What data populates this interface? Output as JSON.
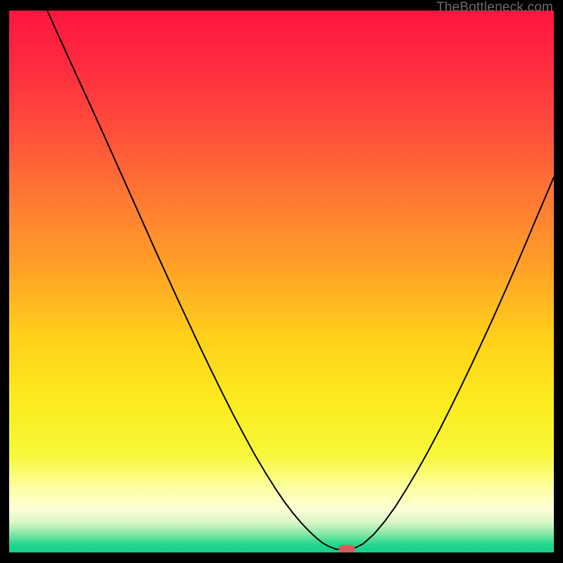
{
  "watermark": "TheBottleneck.com",
  "colors": {
    "frame": "#000000",
    "curve": "#000000",
    "marker_fill": "#d85a5a",
    "marker_stroke": "#d85a5a",
    "gradient_stops": [
      {
        "offset": 0.0,
        "color": "#ff153f"
      },
      {
        "offset": 0.1,
        "color": "#ff2b3f"
      },
      {
        "offset": 0.22,
        "color": "#ff4e3c"
      },
      {
        "offset": 0.35,
        "color": "#ff7a33"
      },
      {
        "offset": 0.48,
        "color": "#ffa326"
      },
      {
        "offset": 0.6,
        "color": "#ffcf1a"
      },
      {
        "offset": 0.72,
        "color": "#fceb1e"
      },
      {
        "offset": 0.82,
        "color": "#f7f83a"
      },
      {
        "offset": 0.88,
        "color": "#fdfea0"
      },
      {
        "offset": 0.92,
        "color": "#fefed8"
      },
      {
        "offset": 0.945,
        "color": "#d9f7c6"
      },
      {
        "offset": 0.965,
        "color": "#88e9a6"
      },
      {
        "offset": 0.985,
        "color": "#24d890"
      },
      {
        "offset": 1.0,
        "color": "#17cf88"
      }
    ]
  },
  "chart_data": {
    "type": "line",
    "title": "",
    "xlabel": "",
    "ylabel": "",
    "xlim": [
      0,
      100
    ],
    "ylim": [
      0,
      100
    ],
    "x": [
      7.0,
      9.0,
      11.0,
      13.0,
      15.0,
      17.0,
      19.0,
      21.0,
      23.0,
      25.0,
      27.0,
      29.0,
      31.0,
      33.0,
      35.0,
      37.0,
      39.0,
      41.0,
      43.0,
      45.0,
      47.0,
      49.0,
      50.5,
      52.0,
      53.5,
      55.0,
      56.5,
      57.5,
      58.5,
      60.0,
      61.5,
      63.0,
      65.0,
      67.0,
      69.0,
      71.0,
      73.0,
      75.0,
      77.0,
      79.0,
      81.0,
      83.0,
      85.0,
      87.0,
      89.0,
      91.0,
      93.0,
      95.0,
      97.0,
      99.0,
      100.0
    ],
    "values": [
      100.0,
      95.5,
      91.1,
      86.7,
      82.3,
      77.9,
      73.4,
      68.9,
      64.4,
      59.9,
      55.4,
      51.0,
      46.6,
      42.3,
      38.0,
      33.8,
      29.7,
      25.7,
      21.9,
      18.2,
      14.8,
      11.6,
      9.4,
      7.4,
      5.6,
      4.0,
      2.6,
      1.8,
      1.2,
      0.6,
      0.6,
      0.6,
      1.6,
      3.4,
      5.8,
      8.6,
      11.8,
      15.2,
      18.8,
      22.6,
      26.6,
      30.7,
      34.9,
      39.2,
      43.6,
      48.1,
      52.7,
      57.4,
      62.2,
      66.9,
      69.3
    ],
    "marker": {
      "x": 62.0,
      "y": 0.6
    }
  }
}
